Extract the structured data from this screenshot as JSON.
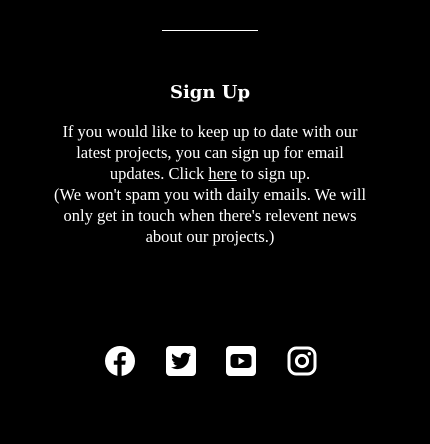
{
  "signup": {
    "heading": "Sign Up",
    "text_before_link": "If you would like to keep up to date with our latest projects, you can sign up for email updates. Click ",
    "link_text": "here",
    "text_after_link": " to sign up.",
    "note": "(We won't spam you with daily emails. We will only get in touch when there's relevent news about our projects.)"
  },
  "social": {
    "icons": [
      "facebook-icon",
      "twitter-icon",
      "youtube-icon",
      "instagram-icon"
    ]
  },
  "colors": {
    "background": "#000000",
    "foreground": "#ffffff"
  }
}
